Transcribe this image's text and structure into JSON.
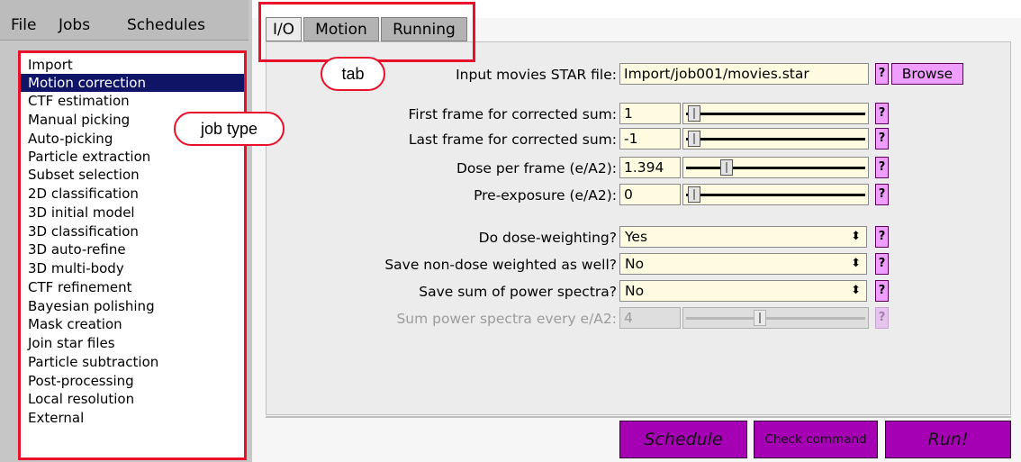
{
  "menubar": {
    "file": "File",
    "jobs": "Jobs",
    "schedules": "Schedules"
  },
  "job_types": [
    "Import",
    "Motion correction",
    "CTF estimation",
    "Manual picking",
    "Auto-picking",
    "Particle extraction",
    "Subset selection",
    "2D classification",
    "3D initial model",
    "3D classification",
    "3D auto-refine",
    "3D multi-body",
    "CTF refinement",
    "Bayesian polishing",
    "Mask creation",
    "Join star files",
    "Particle subtraction",
    "Post-processing",
    "Local resolution",
    "External"
  ],
  "selected_job": "Motion correction",
  "annotations": {
    "job_type": "job type",
    "tab": "tab"
  },
  "tabs": [
    "I/O",
    "Motion",
    "Running"
  ],
  "io": {
    "input_movies_label": "Input movies STAR file:",
    "input_movies_value": "Import/job001/movies.star",
    "browse_label": "Browse"
  },
  "fields": {
    "first_frame_label": "First frame for corrected sum:",
    "first_frame_value": "1",
    "last_frame_label": "Last frame for corrected sum:",
    "last_frame_value": "-1",
    "dose_label": "Dose per frame (e/A2):",
    "dose_value": "1.394",
    "preexp_label": "Pre-exposure (e/A2):",
    "preexp_value": "0",
    "doseweight_label": "Do dose-weighting?",
    "doseweight_value": "Yes",
    "nondose_label": "Save non-dose weighted as well?",
    "nondose_value": "No",
    "powerspec_label": "Save sum of power spectra?",
    "powerspec_value": "No",
    "sumpower_label": "Sum power spectra every e/A2:",
    "sumpower_value": "4"
  },
  "help_glyph": "?",
  "select_arrows": "⬍",
  "actions": {
    "schedule": "Schedule",
    "check": "Check command",
    "run": "Run!"
  },
  "colors": {
    "accent_purple": "#a500b4",
    "help_pink": "#ef9dff",
    "selection_navy": "#0f1466",
    "annotation_red": "#e8102b"
  }
}
